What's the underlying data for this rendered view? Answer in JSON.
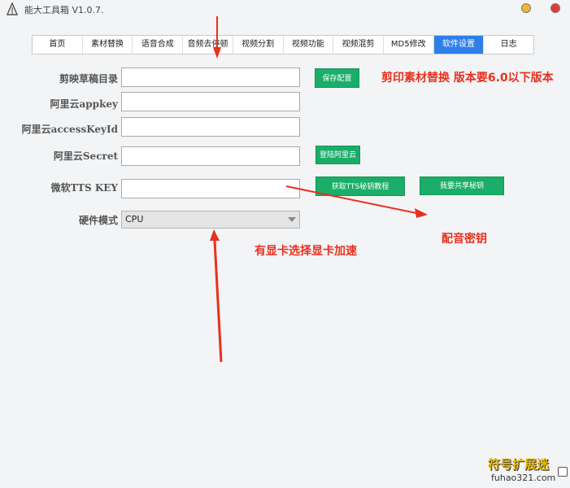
{
  "app": {
    "title": "能大工具箱 V1.0.7."
  },
  "tabs": [
    {
      "label": "首页"
    },
    {
      "label": "素材替换"
    },
    {
      "label": "语音合成"
    },
    {
      "label": "音频去停顿"
    },
    {
      "label": "视频分割"
    },
    {
      "label": "视频功能"
    },
    {
      "label": "视频混剪"
    },
    {
      "label": "MD5修改"
    },
    {
      "label": "软件设置",
      "active": true
    },
    {
      "label": "日志"
    }
  ],
  "form": {
    "draft_dir_label": "剪映草稿目录",
    "draft_dir_value": "",
    "appkey_label": "阿里云appkey",
    "appkey_value": "",
    "access_key_label": "阿里云accessKeyId",
    "access_key_value": "",
    "secret_label": "阿里云Secret",
    "secret_value": "",
    "tts_label": "微软TTS KEY",
    "tts_value": "",
    "hardware_label": "硬件模式",
    "hardware_value": "CPU"
  },
  "buttons": {
    "save_config": "保存配置",
    "login_aliyun": "登陆阿里云",
    "get_tts_tutorial": "获取TTS秘钥教程",
    "share_key": "我要共享秘钥"
  },
  "annotations": {
    "version_note": "剪印素材替换 版本要6.0以下版本",
    "key_note": "配音密钥",
    "gpu_note": "有显卡选择显卡加速"
  },
  "watermark": {
    "main": "符号扩展迷",
    "sub": "fuhao321.com"
  },
  "colors": {
    "accent_blue": "#2f7fe8",
    "button_green": "#1aae68",
    "annotation_red": "#e8301e"
  }
}
